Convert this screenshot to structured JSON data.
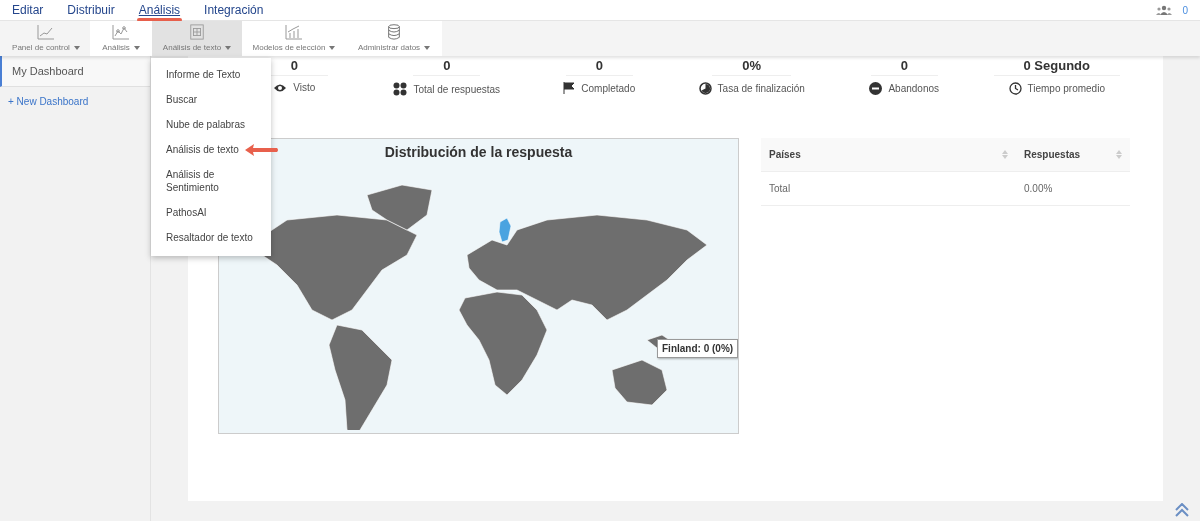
{
  "top_menu": [
    {
      "label": "Editar",
      "selected": false
    },
    {
      "label": "Distribuir",
      "selected": false
    },
    {
      "label": "Análisis",
      "selected": true
    },
    {
      "label": "Integración",
      "selected": false
    }
  ],
  "user_count": "0",
  "toolbar": [
    {
      "label": "Panel de control",
      "selected": false
    },
    {
      "label": "Análisis",
      "selected": false
    },
    {
      "label": "Análisis de texto",
      "selected": true
    },
    {
      "label": "Modelos de elección",
      "selected": false
    },
    {
      "label": "Administrar datos",
      "selected": false
    }
  ],
  "sidebar": {
    "items": [
      {
        "label": "My Dashboard",
        "selected": true
      }
    ],
    "new_dashboard": "+ New Dashboard"
  },
  "dropdown": [
    {
      "label": "Informe de Texto",
      "pointed": false
    },
    {
      "label": "Buscar",
      "pointed": false
    },
    {
      "label": "Nube de palabras",
      "pointed": false
    },
    {
      "label": "Análisis de texto",
      "pointed": true
    },
    {
      "label": "Análisis de Sentimiento",
      "pointed": false
    },
    {
      "label": "PathosAI",
      "pointed": false
    },
    {
      "label": "Resaltador de texto",
      "pointed": false
    }
  ],
  "stats": [
    {
      "value": "0",
      "label": "Visto"
    },
    {
      "value": "0",
      "label": "Total de respuestas"
    },
    {
      "value": "0",
      "label": "Completado"
    },
    {
      "value": "0%",
      "label": "Tasa de finalización"
    },
    {
      "value": "0",
      "label": "Abandonos"
    },
    {
      "value": "0 Segundo",
      "label": "Tiempo promedio"
    }
  ],
  "map": {
    "title": "Distribución de la respuesta",
    "tooltip": "Finland: 0 (0%)"
  },
  "table": {
    "columns": [
      "Países",
      "Respuestas"
    ],
    "rows": [
      [
        "Total",
        "0.00%"
      ]
    ]
  }
}
